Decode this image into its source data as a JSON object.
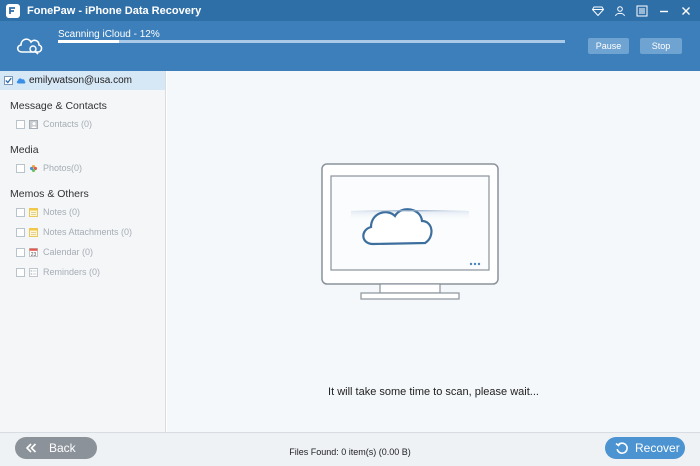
{
  "app": {
    "title": "FonePaw - iPhone Data Recovery",
    "controls": [
      "diamond-icon",
      "account-icon",
      "menu-icon",
      "minimize-icon",
      "close-icon"
    ]
  },
  "scan": {
    "status_text": "Scanning iCloud - 12%",
    "progress": 0.12,
    "pause_label": "Pause",
    "stop_label": "Stop"
  },
  "sidebar": {
    "account": "emilywatson@usa.com",
    "sections": [
      {
        "title": "Message & Contacts",
        "items": [
          {
            "label": "Contacts (0)",
            "icon": "contacts-icon"
          }
        ]
      },
      {
        "title": "Media",
        "items": [
          {
            "label": "Photos(0)",
            "icon": "photos-icon"
          }
        ]
      },
      {
        "title": "Memos & Others",
        "items": [
          {
            "label": "Notes (0)",
            "icon": "notes-icon"
          },
          {
            "label": "Notes Attachments (0)",
            "icon": "notes-attachments-icon"
          },
          {
            "label": "Calendar (0)",
            "icon": "calendar-icon"
          },
          {
            "label": "Reminders (0)",
            "icon": "reminders-icon"
          }
        ]
      }
    ]
  },
  "main": {
    "wait_text": "It will take some time to scan, please wait..."
  },
  "footer": {
    "back_label": "Back",
    "files_found": "Files Found: 0 item(s) (0.00 B)",
    "recover_label": "Recover"
  },
  "colors": {
    "titlebar": "#2f6fa8",
    "header": "#3d7fba",
    "accent": "#4b93d1",
    "back_button": "#8b9299"
  }
}
